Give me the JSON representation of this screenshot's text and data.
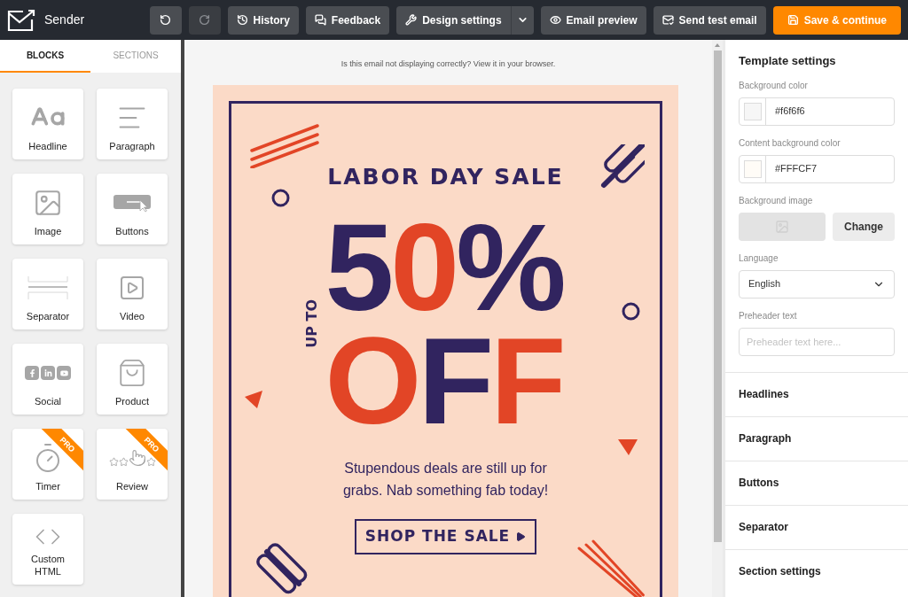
{
  "app": {
    "name": "Sender"
  },
  "toolbar": [
    {
      "kind": "icon",
      "disabled": false
    },
    {
      "kind": "icon",
      "disabled": true
    },
    {
      "kind": "text",
      "label": "History"
    },
    {
      "kind": "text",
      "label": "Feedback"
    },
    {
      "kind": "split",
      "label": "Design settings"
    },
    {
      "kind": "text",
      "label": "Email preview"
    },
    {
      "kind": "text",
      "label": "Send test email"
    },
    {
      "kind": "primary",
      "label": "Save & continue"
    }
  ],
  "left_tabs": [
    {
      "label": "BLOCKS",
      "selected": true
    },
    {
      "label": "SECTIONS",
      "selected": false
    }
  ],
  "blocks": [
    {
      "label": "Headline"
    },
    {
      "label": "Paragraph"
    },
    {
      "label": "Image"
    },
    {
      "label": "Buttons"
    },
    {
      "label": "Separator"
    },
    {
      "label": "Video"
    },
    {
      "label": "Social"
    },
    {
      "label": "Product"
    },
    {
      "label": "Timer",
      "badge": "PRO"
    },
    {
      "label": "Review",
      "badge": "PRO"
    },
    {
      "label": "Custom HTML"
    }
  ],
  "canvas": {
    "notice": "Is this email not displaying correctly? View it in your browser.",
    "email": {
      "title": "LABOR DAY SALE",
      "side_text": "UP TO",
      "big_lines": [
        [
          {
            "char": "5",
            "color": "#31245f"
          },
          {
            "char": "0",
            "color": "#e24526"
          },
          {
            "char": "%",
            "color": "#31245f"
          }
        ],
        [
          {
            "char": "O",
            "color": "#e24526"
          },
          {
            "char": "F",
            "color": "#31245f"
          },
          {
            "char": "F",
            "color": "#e24526"
          }
        ]
      ],
      "body": "Stupendous deals are still up for grabs. Nab something fab today!",
      "cta": "SHOP THE SALE"
    }
  },
  "settings": {
    "title": "Template settings",
    "fields": [
      {
        "kind": "color",
        "label": "Background color",
        "value": "#f6f6f6",
        "color": "#f6f6f6"
      },
      {
        "kind": "color",
        "label": "Content background color",
        "value": "#FFFCF7",
        "color": "#fffcf7"
      },
      {
        "kind": "image",
        "label": "Background image",
        "button": "Change"
      },
      {
        "kind": "select",
        "label": "Language",
        "value": "English"
      },
      {
        "kind": "text",
        "label": "Preheader text",
        "placeholder": "Preheader text here..."
      }
    ],
    "sections": [
      {
        "label": "Headlines"
      },
      {
        "label": "Paragraph"
      },
      {
        "label": "Buttons"
      },
      {
        "label": "Separator"
      },
      {
        "label": "Section settings"
      }
    ]
  }
}
